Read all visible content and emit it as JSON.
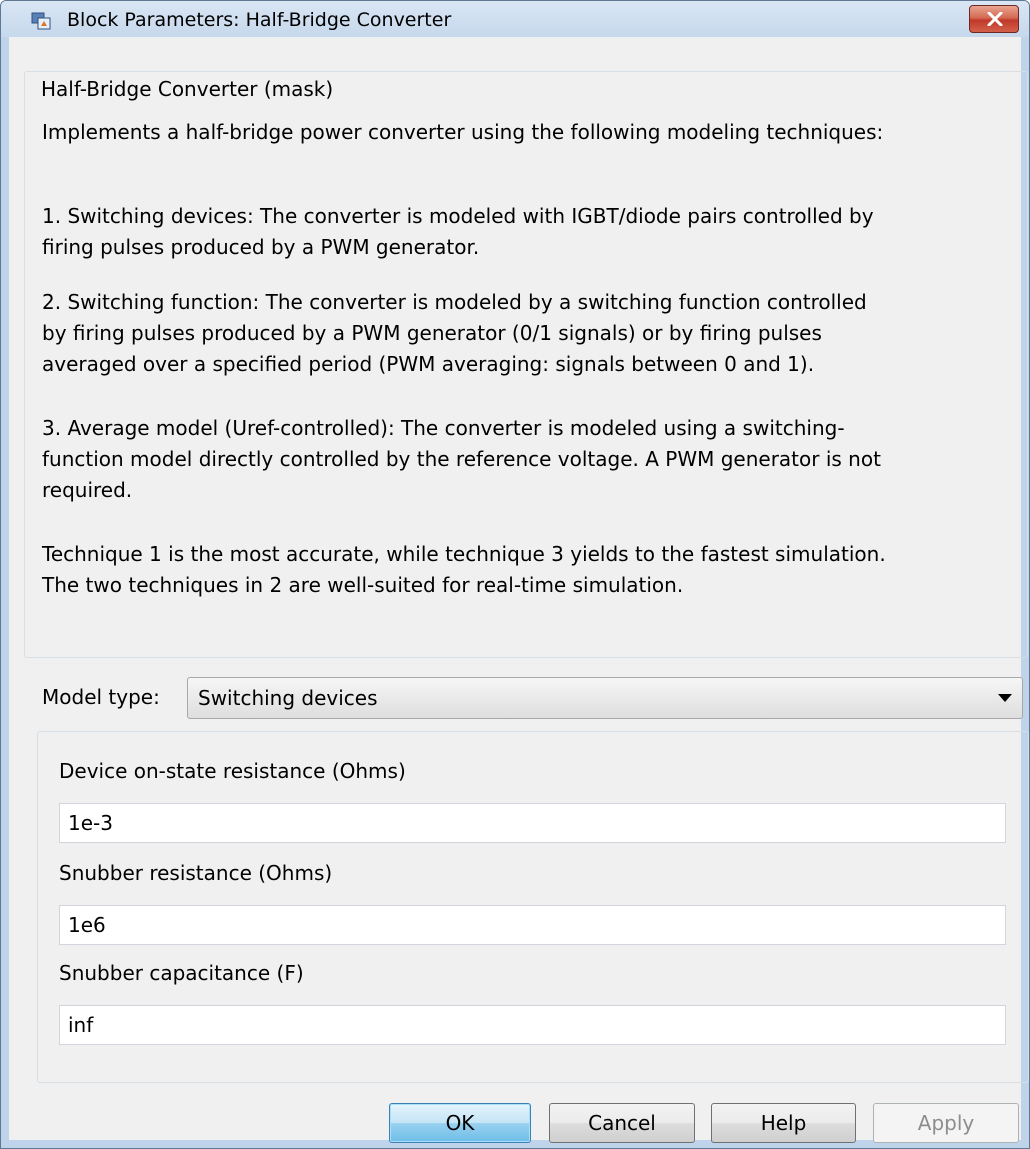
{
  "window": {
    "title": "Block Parameters: Half-Bridge Converter",
    "close_icon": "close-icon"
  },
  "mask": {
    "legend": "Half-Bridge Converter (mask)",
    "description_lines": [
      "Implements a half-bridge power converter using the following modeling techniques:",
      "1. Switching devices: The converter is modeled with IGBT/diode pairs controlled by",
      "firing pulses produced by a PWM generator.",
      "2. Switching function: The converter is modeled by a switching function controlled",
      "by firing pulses produced by a PWM generator (0/1 signals) or by firing pulses",
      "averaged over a specified period (PWM averaging: signals between 0 and 1).",
      "3. Average model (Uref-controlled): The converter is modeled using a switching-",
      "function model directly controlled by the reference voltage. A PWM generator is not",
      "required.",
      "Technique 1 is the most accurate, while technique 3 yields to the fastest simulation.",
      "The two techniques in 2 are well-suited for real-time simulation."
    ]
  },
  "model_type": {
    "label": "Model type:",
    "selected": "Switching devices"
  },
  "parameters": [
    {
      "label": "Device on-state resistance (Ohms)",
      "value": "1e-3"
    },
    {
      "label": "Snubber resistance (Ohms)",
      "value": "1e6"
    },
    {
      "label": "Snubber capacitance (F)",
      "value": "inf"
    }
  ],
  "buttons": {
    "ok": "OK",
    "cancel": "Cancel",
    "help": "Help",
    "apply": "Apply"
  },
  "colors": {
    "title_bar": "#c6d8ec",
    "client_background": "#f0f0f0",
    "close_button": "#c1392a",
    "default_button": "#98d1ef"
  }
}
